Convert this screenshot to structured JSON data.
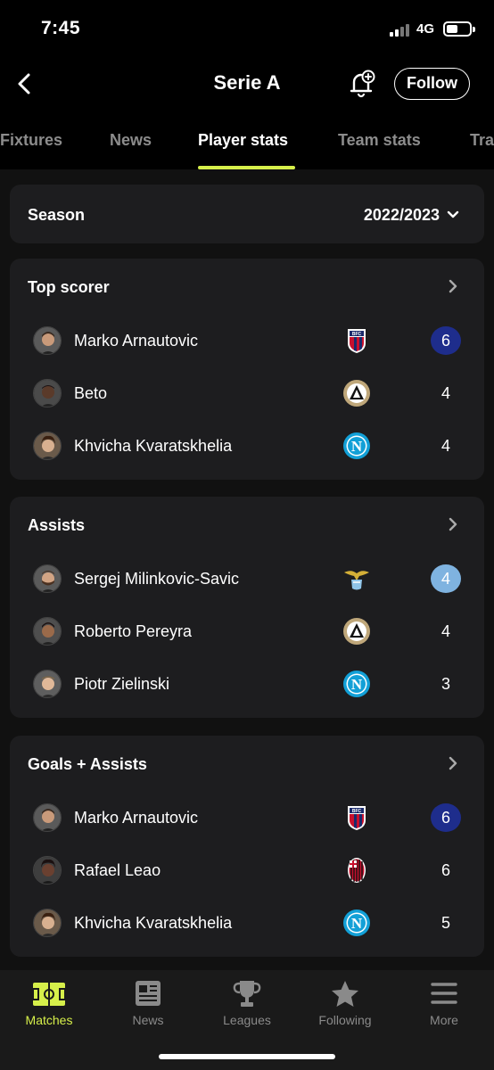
{
  "status_bar": {
    "time": "7:45",
    "network": "4G"
  },
  "header": {
    "title": "Serie A",
    "follow_label": "Follow"
  },
  "tabs": [
    {
      "label": "Fixtures",
      "active": false
    },
    {
      "label": "News",
      "active": false
    },
    {
      "label": "Player stats",
      "active": true
    },
    {
      "label": "Team stats",
      "active": false
    },
    {
      "label": "Tra",
      "active": false
    }
  ],
  "season": {
    "label": "Season",
    "value": "2022/2023"
  },
  "sections": [
    {
      "title": "Top scorer",
      "rows": [
        {
          "name": "Marko Arnautovic",
          "team_icon": "bologna-crest",
          "value": "6",
          "highlight": "dark"
        },
        {
          "name": "Beto",
          "team_icon": "udinese-crest",
          "value": "4",
          "highlight": ""
        },
        {
          "name": "Khvicha Kvaratskhelia",
          "team_icon": "napoli-crest",
          "value": "4",
          "highlight": ""
        }
      ]
    },
    {
      "title": "Assists",
      "rows": [
        {
          "name": "Sergej Milinkovic-Savic",
          "team_icon": "lazio-crest",
          "value": "4",
          "highlight": "light"
        },
        {
          "name": "Roberto Pereyra",
          "team_icon": "udinese-crest",
          "value": "4",
          "highlight": ""
        },
        {
          "name": "Piotr Zielinski",
          "team_icon": "napoli-crest",
          "value": "3",
          "highlight": ""
        }
      ]
    },
    {
      "title": "Goals + Assists",
      "rows": [
        {
          "name": "Marko Arnautovic",
          "team_icon": "bologna-crest",
          "value": "6",
          "highlight": "dark"
        },
        {
          "name": "Rafael Leao",
          "team_icon": "milan-crest",
          "value": "6",
          "highlight": ""
        },
        {
          "name": "Khvicha Kvaratskhelia",
          "team_icon": "napoli-crest",
          "value": "5",
          "highlight": ""
        }
      ]
    }
  ],
  "bottom_nav": [
    {
      "label": "Matches",
      "icon": "pitch-icon",
      "active": true
    },
    {
      "label": "News",
      "icon": "news-icon",
      "active": false
    },
    {
      "label": "Leagues",
      "icon": "trophy-icon",
      "active": false
    },
    {
      "label": "Following",
      "icon": "star-icon",
      "active": false
    },
    {
      "label": "More",
      "icon": "menu-icon",
      "active": false
    }
  ],
  "colors": {
    "accent": "#d6ef4a",
    "card": "#1d1d1f",
    "highlight_dark": "#1e2d8c",
    "highlight_light": "#7fb3e0"
  }
}
